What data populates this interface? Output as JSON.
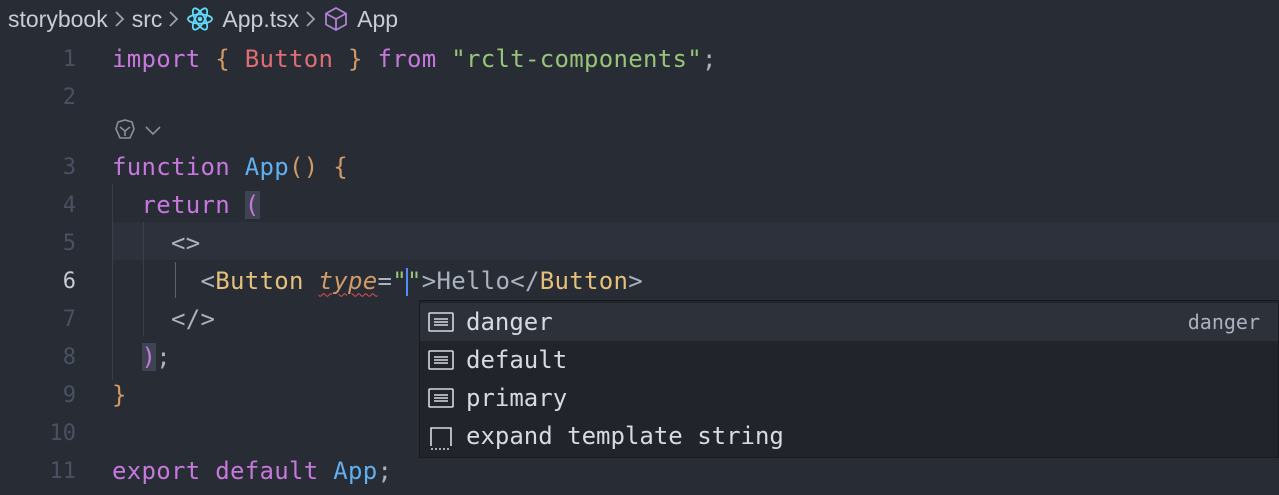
{
  "breadcrumb": {
    "items": [
      {
        "label": "storybook"
      },
      {
        "label": "src"
      },
      {
        "label": "App.tsx",
        "icon": "react-icon"
      },
      {
        "label": "App",
        "icon": "cube-icon"
      }
    ]
  },
  "editor": {
    "active_line": 6,
    "line_numbers": [
      "1",
      "2",
      "3",
      "4",
      "5",
      "6",
      "7",
      "8",
      "9",
      "10",
      "11"
    ],
    "lines": {
      "l1": {
        "kw1": "import",
        "b1": "{",
        "id": "Button",
        "b2": "}",
        "kw2": "from",
        "str": "\"rclt-components\"",
        "end": ";"
      },
      "l3": {
        "kw": "function",
        "fn": "App",
        "paren": "()",
        "brace": "{"
      },
      "l4": {
        "kw": "return",
        "paren": "("
      },
      "l5": {
        "frag": "<>"
      },
      "l6": {
        "open_lt": "<",
        "tag": "Button",
        "attr": "type",
        "eq": "=",
        "q1": "\"",
        "q2": "\"",
        "gt": ">",
        "text": "Hello",
        "close_lt": "</",
        "close_tag": "Button",
        "close_gt": ">"
      },
      "l7": {
        "frag": "</>"
      },
      "l8": {
        "paren": ")",
        "end": ";"
      },
      "l9": {
        "brace": "}"
      },
      "l11": {
        "kw1": "export",
        "kw2": "default",
        "id": "App",
        "end": ";"
      }
    },
    "codelens_icon": "copilot-icon"
  },
  "suggest": {
    "items": [
      {
        "label": "danger",
        "detail": "danger",
        "icon": "text-enum-icon",
        "selected": true
      },
      {
        "label": "default",
        "icon": "text-enum-icon"
      },
      {
        "label": "primary",
        "icon": "text-enum-icon"
      },
      {
        "label": "expand template string",
        "icon": "snippet-icon"
      }
    ]
  },
  "colors": {
    "background": "#282c34",
    "keyword": "#c678dd",
    "function": "#61afef",
    "string": "#98c379",
    "type": "#e5c07b",
    "bracket": "#d19a66"
  }
}
